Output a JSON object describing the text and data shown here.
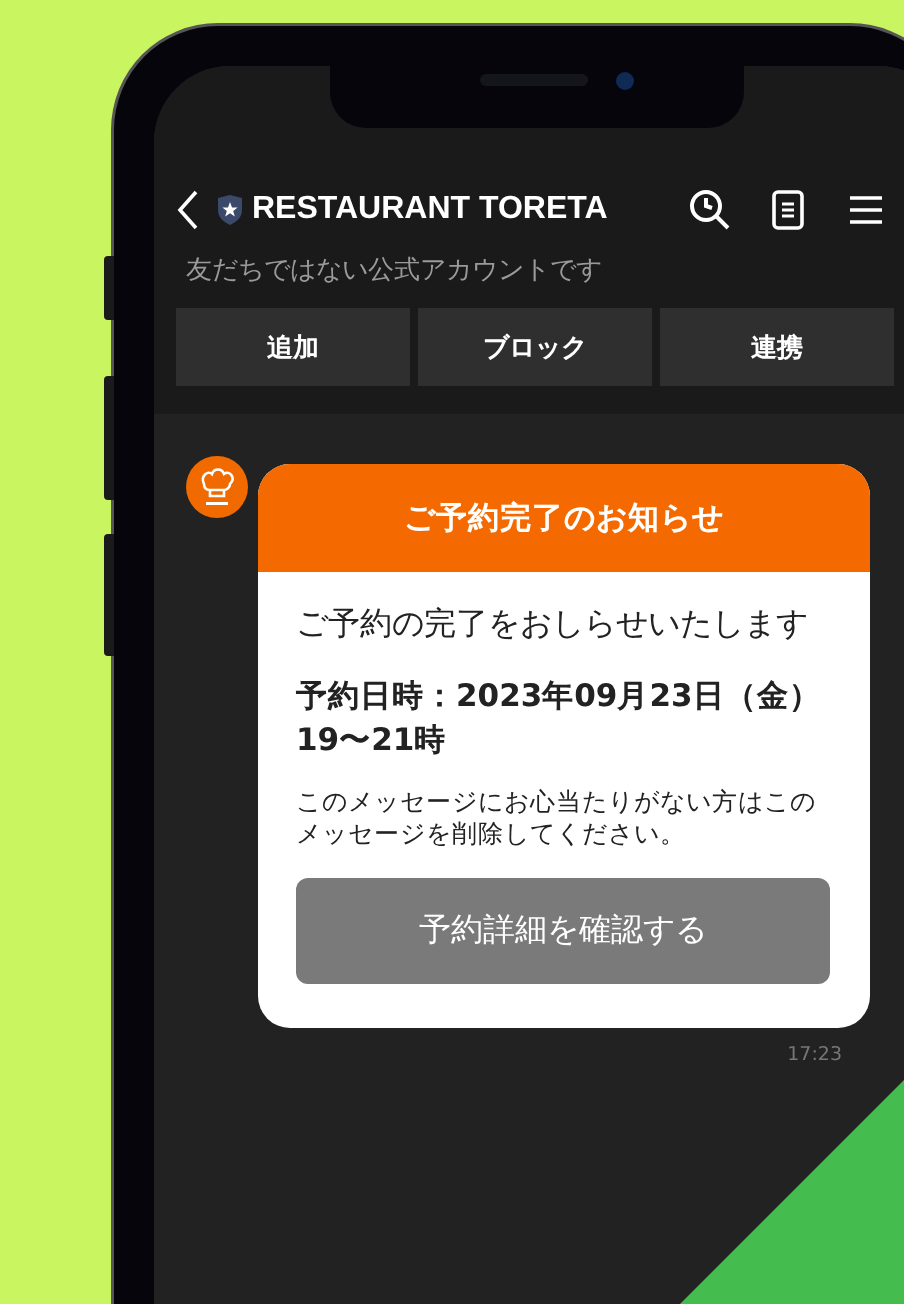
{
  "chat_header": {
    "title": "RESTAURANT TORETA",
    "subtitle": "友だちではない公式アカウントです"
  },
  "actions": [
    "追加",
    "ブロック",
    "連携"
  ],
  "message": {
    "header": "ご予約完了のお知らせ",
    "lead": "ご予約の完了をおしらせいたします",
    "datetime_lines": [
      "予約日時：2023年09月23日（金）",
      "19〜21時"
    ],
    "note": "このメッセージにお心当たりがない方はこのメッセージを削除してください。",
    "button": "予約詳細を確認する",
    "time": "17:23"
  }
}
